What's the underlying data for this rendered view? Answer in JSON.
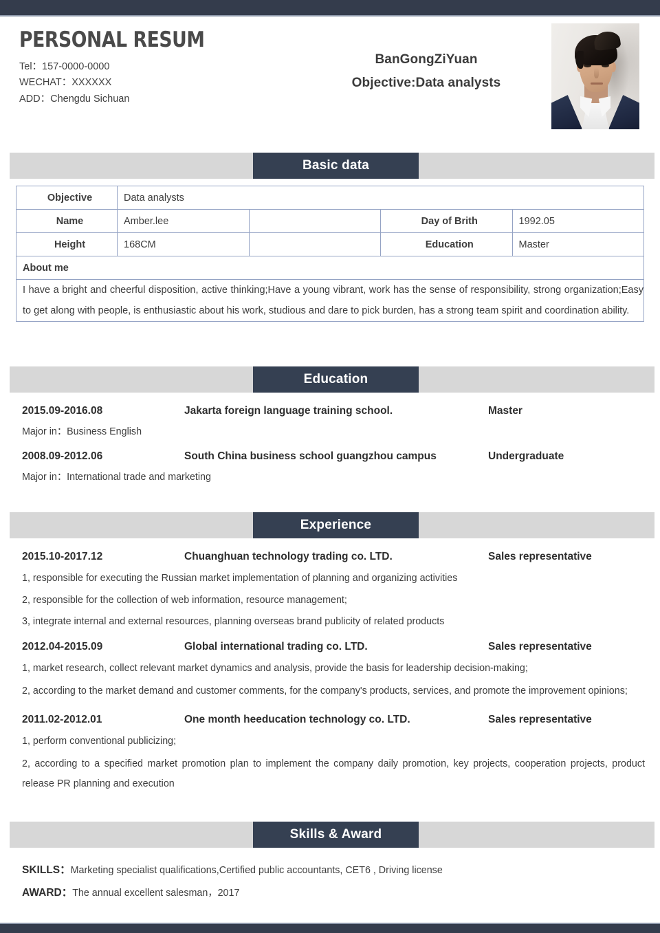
{
  "header": {
    "title": "PERSONAL RESUM",
    "contacts": [
      "Tel：157-0000-0000",
      "WECHAT：XXXXXX",
      "ADD：Chengdu Sichuan"
    ],
    "person_name": "BanGongZiYuan",
    "objective": "Objective:Data analysts",
    "photo_alt": "portrait-photo"
  },
  "colors": {
    "navy": "#354052",
    "bar": "#343c4c",
    "band_gray": "#d7d7d7",
    "table_border": "#94a3c4",
    "text": "#3d3d3d"
  },
  "sections": {
    "basic": {
      "title": "Basic data"
    },
    "education": {
      "title": "Education"
    },
    "experience": {
      "title": "Experience"
    },
    "skills": {
      "title": "Skills & Award"
    }
  },
  "basic_table": {
    "objective_label": "Objective",
    "objective_value": "Data analysts",
    "name_label": "Name",
    "name_value": "Amber.lee",
    "birth_label": "Day of Brith",
    "birth_value": "1992.05",
    "height_label": "Height",
    "height_value": "168CM",
    "education_label": "Education",
    "education_value": "Master",
    "about_label": "About me",
    "about_value": "I have a bright and cheerful disposition, active thinking;Have a young vibrant, work has the sense of responsibility, strong organization;Easy to get along with people, is enthusiastic about his work, studious and dare to pick burden, has a strong team spirit and coordination ability."
  },
  "education_entries": [
    {
      "date": "2015.09-2016.08",
      "org": "Jakarta foreign language training school.",
      "role": "Master",
      "major": "Major in：Business English"
    },
    {
      "date": "2008.09-2012.06",
      "org": "South China business school guangzhou campus",
      "role": "Undergraduate",
      "major": "Major in：International trade and marketing"
    }
  ],
  "experience_entries": [
    {
      "date": "2015.10-2017.12",
      "org": "Chuanghuan technology trading co. LTD.",
      "role": "Sales representative",
      "bullets": [
        "1, responsible for executing the Russian market implementation of planning and organizing activities",
        "2, responsible for the collection of web information, resource management;",
        "3, integrate internal and external resources, planning overseas brand publicity of related products"
      ]
    },
    {
      "date": "2012.04-2015.09",
      "org": "Global international trading co. LTD.",
      "role": "Sales representative",
      "bullets": [
        "1, market research, collect relevant market dynamics and analysis, provide the basis for leadership decision-making;",
        "2, according to the market demand and customer comments, for the company's products, services, and promote the improvement opinions;"
      ]
    },
    {
      "date": "2011.02-2012.01",
      "org": "One month heeducation technology co. LTD.",
      "role": "Sales representative",
      "bullets": [
        "1, perform conventional publicizing;",
        "2, according to a specified market promotion plan to implement the company daily promotion, key projects, cooperation projects, product release PR planning and execution"
      ]
    }
  ],
  "skills_section": {
    "skills_label": "SKILLS：",
    "skills_value": "Marketing specialist qualifications,Certified public accountants, CET6 , Driving license",
    "award_label": "AWARD：",
    "award_value": "The annual excellent salesman，2017"
  }
}
